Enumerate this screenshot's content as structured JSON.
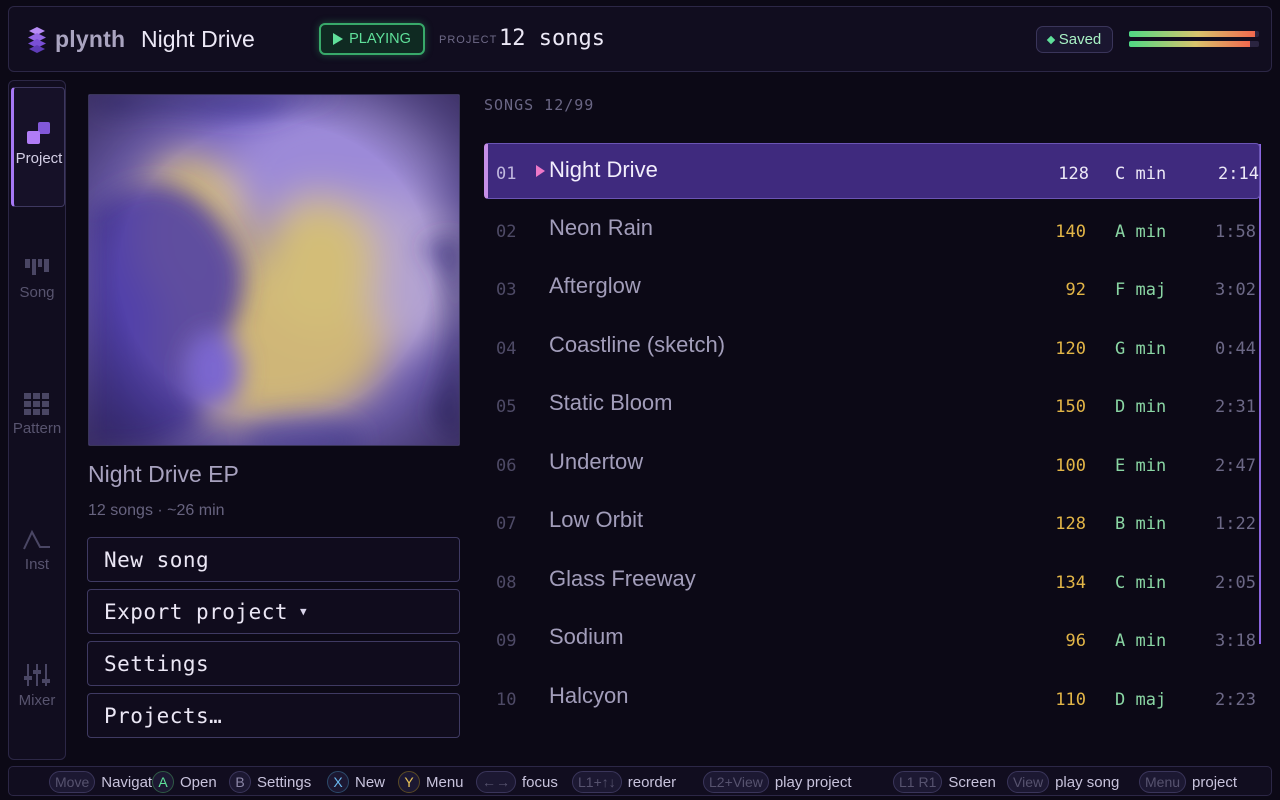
{
  "topbar": {
    "logo_text": "plynth",
    "song_title": "Night Drive",
    "status": "PLAYING",
    "project_label": "PROJECT",
    "project_count": "12 songs",
    "saved_label": "Saved",
    "meter_levels": [
      0.97,
      0.93
    ]
  },
  "nav": {
    "items": [
      {
        "label": "Project",
        "icon": "project-icon",
        "active": true
      },
      {
        "label": "Song",
        "icon": "song-icon",
        "active": false
      },
      {
        "label": "Pattern",
        "icon": "pattern-icon",
        "active": false
      },
      {
        "label": "Inst",
        "icon": "instrument-icon",
        "active": false
      },
      {
        "label": "Mixer",
        "icon": "mixer-icon",
        "active": false
      }
    ]
  },
  "album": {
    "name": "Night Drive EP",
    "meta": "12 songs · ~26 min"
  },
  "actions": {
    "new_song": "New song",
    "export_project": "Export project",
    "settings": "Settings",
    "projects": "Projects…"
  },
  "songs": {
    "header": "SONGS 12/99",
    "rows": [
      {
        "num": "01",
        "name": "Night Drive",
        "bpm": "128",
        "key": "C min",
        "dur": "2:14"
      },
      {
        "num": "02",
        "name": "Neon Rain",
        "bpm": "140",
        "key": "A min",
        "dur": "1:58"
      },
      {
        "num": "03",
        "name": "Afterglow",
        "bpm": "92",
        "key": "F maj",
        "dur": "3:02"
      },
      {
        "num": "04",
        "name": "Coastline (sketch)",
        "bpm": "120",
        "key": "G min",
        "dur": "0:44"
      },
      {
        "num": "05",
        "name": "Static Bloom",
        "bpm": "150",
        "key": "D min",
        "dur": "2:31"
      },
      {
        "num": "06",
        "name": "Undertow",
        "bpm": "100",
        "key": "E min",
        "dur": "2:47"
      },
      {
        "num": "07",
        "name": "Low Orbit",
        "bpm": "128",
        "key": "B min",
        "dur": "1:22"
      },
      {
        "num": "08",
        "name": "Glass Freeway",
        "bpm": "134",
        "key": "C min",
        "dur": "2:05"
      },
      {
        "num": "09",
        "name": "Sodium",
        "bpm": "96",
        "key": "A min",
        "dur": "3:18"
      },
      {
        "num": "10",
        "name": "Halcyon",
        "bpm": "110",
        "key": "D maj",
        "dur": "2:23"
      }
    ]
  },
  "hints": [
    {
      "key": "Move",
      "label": "Navigate",
      "style": "pill"
    },
    {
      "key": "A",
      "label": "Open",
      "style": "a"
    },
    {
      "key": "B",
      "label": "Settings",
      "style": "b"
    },
    {
      "key": "X",
      "label": "New",
      "style": "x"
    },
    {
      "key": "Y",
      "label": "Menu",
      "style": "y"
    },
    {
      "key": "←→",
      "label": "focus",
      "style": "pill"
    },
    {
      "key": "L1+↑↓",
      "label": "reorder",
      "style": "pill"
    },
    {
      "key": "L2+View",
      "label": "play project",
      "style": "pill"
    },
    {
      "key": "L1 R1",
      "label": "Screen",
      "style": "pill"
    },
    {
      "key": "View",
      "label": "play song",
      "style": "pill"
    },
    {
      "key": "Menu",
      "label": "project",
      "style": "pill"
    }
  ],
  "colors": {
    "accent": "#a678f5",
    "active_row": "#3f2a7e",
    "bpm": "#e2b547",
    "key": "#8ad6a4",
    "playing": "#5fe09a"
  }
}
